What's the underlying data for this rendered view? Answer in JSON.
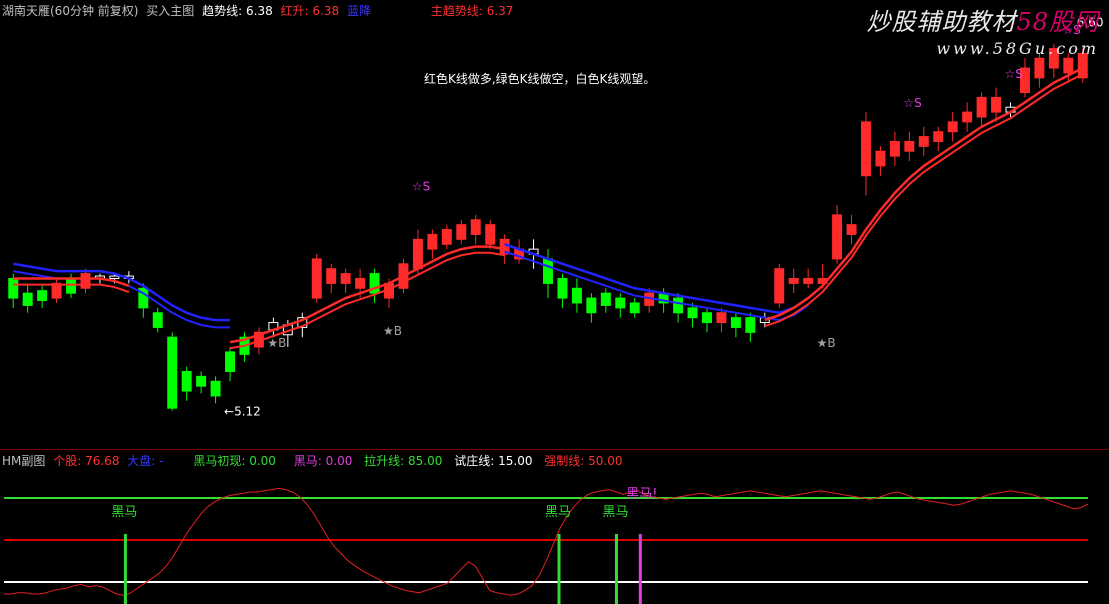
{
  "header": {
    "stock": "湖南天雁(60分钟 前复权)",
    "mode": "买入主图",
    "trend_label": "趋势线:",
    "trend_value": "6.38",
    "red_label": "红升:",
    "red_value": "6.38",
    "blue_label": "蓝降",
    "main_label": "主趋势线:",
    "main_value": "6.37"
  },
  "watermark": {
    "title_pre": "炒股辅助教材",
    "title_brand": "58股网",
    "url": "www.58Gu.com"
  },
  "annotation": "红色K线做多,绿色K线做空，白色K线观望。",
  "sub_header": {
    "name": "HM副图",
    "stock_label": "个股:",
    "stock_value": "76.68",
    "market_label": "大盘:",
    "market_value": "-",
    "hm_first_label": "黑马初现:",
    "hm_first_value": "0.00",
    "hm_label": "黑马:",
    "hm_value": "0.00",
    "rise_label": "拉升线:",
    "rise_value": "85.00",
    "test_label": "试庄线:",
    "test_value": "15.00",
    "crash_label": "强制线:",
    "crash_value": "50.00"
  },
  "colors": {
    "up": "#ff2a2a",
    "down": "#00ff00",
    "neutral": "#ffffff",
    "blue": "#2222ff",
    "magenta": "#e040e0",
    "gray": "#a0a0a0",
    "green_line": "#33dd33",
    "red_line": "#dd0000"
  },
  "chart_data": {
    "type": "candlestick",
    "ylim": [
      5.0,
      6.7
    ],
    "candles": [
      [
        "g",
        5.58,
        5.66,
        5.54,
        5.68
      ],
      [
        "g",
        5.55,
        5.6,
        5.52,
        5.64
      ],
      [
        "g",
        5.57,
        5.61,
        5.54,
        5.63
      ],
      [
        "r",
        5.58,
        5.64,
        5.56,
        5.66
      ],
      [
        "g",
        5.6,
        5.66,
        5.58,
        5.68
      ],
      [
        "r",
        5.62,
        5.68,
        5.6,
        5.7
      ],
      [
        "w",
        5.66,
        5.67,
        5.64,
        5.68
      ],
      [
        "w",
        5.66,
        5.67,
        5.64,
        5.68
      ],
      [
        "w",
        5.66,
        5.67,
        5.64,
        5.69
      ],
      [
        "g",
        5.54,
        5.62,
        5.5,
        5.64
      ],
      [
        "g",
        5.46,
        5.52,
        5.44,
        5.54
      ],
      [
        "g",
        5.13,
        5.42,
        5.12,
        5.44
      ],
      [
        "g",
        5.2,
        5.28,
        5.16,
        5.3
      ],
      [
        "g",
        5.22,
        5.26,
        5.19,
        5.28
      ],
      [
        "g",
        5.18,
        5.24,
        5.15,
        5.26
      ],
      [
        "g",
        5.28,
        5.36,
        5.24,
        5.38
      ],
      [
        "g",
        5.35,
        5.42,
        5.32,
        5.44
      ],
      [
        "r",
        5.38,
        5.44,
        5.35,
        5.46
      ],
      [
        "w",
        5.45,
        5.48,
        5.42,
        5.5
      ],
      [
        "w",
        5.43,
        5.47,
        5.38,
        5.49
      ],
      [
        "w",
        5.46,
        5.5,
        5.42,
        5.52
      ],
      [
        "r",
        5.58,
        5.74,
        5.56,
        5.76
      ],
      [
        "r",
        5.64,
        5.7,
        5.6,
        5.72
      ],
      [
        "r",
        5.64,
        5.68,
        5.6,
        5.7
      ],
      [
        "r",
        5.62,
        5.66,
        5.58,
        5.7
      ],
      [
        "g",
        5.6,
        5.68,
        5.56,
        5.7
      ],
      [
        "r",
        5.58,
        5.64,
        5.54,
        5.66
      ],
      [
        "r",
        5.62,
        5.72,
        5.6,
        5.74
      ],
      [
        "r",
        5.7,
        5.82,
        5.68,
        5.86
      ],
      [
        "r",
        5.78,
        5.84,
        5.74,
        5.86
      ],
      [
        "r",
        5.8,
        5.86,
        5.78,
        5.88
      ],
      [
        "r",
        5.82,
        5.88,
        5.8,
        5.9
      ],
      [
        "r",
        5.84,
        5.9,
        5.8,
        5.92
      ],
      [
        "r",
        5.8,
        5.88,
        5.78,
        5.9
      ],
      [
        "r",
        5.76,
        5.82,
        5.72,
        5.84
      ],
      [
        "r",
        5.74,
        5.78,
        5.72,
        5.82
      ],
      [
        "w",
        5.76,
        5.78,
        5.7,
        5.82
      ],
      [
        "g",
        5.64,
        5.74,
        5.58,
        5.78
      ],
      [
        "g",
        5.58,
        5.66,
        5.54,
        5.68
      ],
      [
        "g",
        5.56,
        5.62,
        5.52,
        5.66
      ],
      [
        "g",
        5.52,
        5.58,
        5.48,
        5.6
      ],
      [
        "g",
        5.55,
        5.6,
        5.52,
        5.62
      ],
      [
        "g",
        5.54,
        5.58,
        5.5,
        5.6
      ],
      [
        "g",
        5.52,
        5.56,
        5.5,
        5.58
      ],
      [
        "r",
        5.55,
        5.6,
        5.52,
        5.62
      ],
      [
        "g",
        5.56,
        5.6,
        5.52,
        5.62
      ],
      [
        "g",
        5.52,
        5.58,
        5.48,
        5.6
      ],
      [
        "g",
        5.5,
        5.54,
        5.46,
        5.56
      ],
      [
        "g",
        5.48,
        5.52,
        5.44,
        5.54
      ],
      [
        "r",
        5.48,
        5.52,
        5.44,
        5.54
      ],
      [
        "g",
        5.46,
        5.5,
        5.42,
        5.52
      ],
      [
        "g",
        5.44,
        5.5,
        5.4,
        5.52
      ],
      [
        "w",
        5.48,
        5.5,
        5.46,
        5.52
      ],
      [
        "r",
        5.56,
        5.7,
        5.54,
        5.72
      ],
      [
        "r",
        5.64,
        5.66,
        5.6,
        5.7
      ],
      [
        "r",
        5.64,
        5.66,
        5.62,
        5.7
      ],
      [
        "r",
        5.64,
        5.66,
        5.62,
        5.72
      ],
      [
        "r",
        5.74,
        5.92,
        5.72,
        5.96
      ],
      [
        "r",
        5.84,
        5.88,
        5.8,
        5.92
      ],
      [
        "r",
        6.08,
        6.3,
        6.0,
        6.34
      ],
      [
        "r",
        6.12,
        6.18,
        6.08,
        6.2
      ],
      [
        "r",
        6.16,
        6.22,
        6.12,
        6.26
      ],
      [
        "r",
        6.18,
        6.22,
        6.14,
        6.26
      ],
      [
        "r",
        6.2,
        6.24,
        6.16,
        6.28
      ],
      [
        "r",
        6.22,
        6.26,
        6.18,
        6.28
      ],
      [
        "r",
        6.26,
        6.3,
        6.22,
        6.34
      ],
      [
        "r",
        6.3,
        6.34,
        6.26,
        6.38
      ],
      [
        "r",
        6.32,
        6.4,
        6.28,
        6.42
      ],
      [
        "r",
        6.34,
        6.4,
        6.3,
        6.44
      ],
      [
        "w",
        6.34,
        6.36,
        6.32,
        6.38
      ],
      [
        "r",
        6.42,
        6.52,
        6.4,
        6.56
      ],
      [
        "r",
        6.48,
        6.56,
        6.44,
        6.58
      ],
      [
        "r",
        6.52,
        6.6,
        6.48,
        6.62
      ],
      [
        "r",
        6.5,
        6.56,
        6.46,
        6.58
      ],
      [
        "r",
        6.48,
        6.58,
        6.46,
        6.6
      ]
    ],
    "trend_ma": [
      5.66,
      5.66,
      5.66,
      5.66,
      5.66,
      5.66,
      5.66,
      5.65,
      5.63,
      5.59,
      5.54,
      5.48,
      5.44,
      5.41,
      5.4,
      5.4,
      5.41,
      5.43,
      5.45,
      5.47,
      5.49,
      5.52,
      5.55,
      5.58,
      5.6,
      5.62,
      5.64,
      5.67,
      5.7,
      5.73,
      5.76,
      5.78,
      5.79,
      5.79,
      5.78,
      5.76,
      5.74,
      5.71,
      5.68,
      5.65,
      5.62,
      5.6,
      5.58,
      5.56,
      5.55,
      5.54,
      5.53,
      5.52,
      5.51,
      5.5,
      5.49,
      5.49,
      5.49,
      5.51,
      5.54,
      5.58,
      5.63,
      5.7,
      5.77,
      5.86,
      5.94,
      6.01,
      6.07,
      6.12,
      6.16,
      6.2,
      6.24,
      6.28,
      6.31,
      6.34,
      6.38,
      6.42,
      6.46,
      6.49,
      6.52
    ],
    "blue_ma": [
      5.72,
      5.71,
      5.7,
      5.69,
      5.69,
      5.69,
      5.69,
      5.68,
      5.66,
      5.63,
      5.59,
      5.55,
      5.52,
      5.5,
      5.49,
      5.49,
      5.5,
      5.52,
      5.54,
      5.56,
      5.58,
      5.6,
      5.62,
      5.64,
      5.66,
      5.68,
      5.7,
      5.72,
      5.74,
      5.76,
      5.78,
      5.8,
      5.81,
      5.81,
      5.8,
      5.78,
      5.76,
      5.74,
      5.72,
      5.7,
      5.68,
      5.66,
      5.64,
      5.62,
      5.61,
      5.6,
      5.59,
      5.58,
      5.57,
      5.56,
      5.55,
      5.54,
      5.53,
      5.52,
      5.54,
      5.58,
      5.63,
      5.7,
      5.77,
      5.86,
      5.94,
      6.01,
      6.07,
      6.12,
      6.16,
      6.2,
      6.24,
      6.28,
      6.31,
      6.34,
      6.38,
      6.42,
      6.46,
      6.49,
      6.52
    ],
    "markers": [
      {
        "i": 15,
        "text": "←5.12",
        "price": 5.1,
        "color": "#ffffff"
      },
      {
        "i": 18,
        "text": "★B",
        "price": 5.38,
        "color": "#a0a0a0"
      },
      {
        "i": 26,
        "text": "★B",
        "price": 5.43,
        "color": "#a0a0a0"
      },
      {
        "i": 28,
        "text": "☆S",
        "price": 6.02,
        "color": "#e040e0"
      },
      {
        "i": 56,
        "text": "★B",
        "price": 5.38,
        "color": "#a0a0a0"
      },
      {
        "i": 62,
        "text": "☆S",
        "price": 6.36,
        "color": "#e040e0"
      },
      {
        "i": 69,
        "text": "☆S",
        "price": 6.48,
        "color": "#e040e0"
      },
      {
        "i": 73,
        "text": "☆S",
        "price": 6.66,
        "color": "#e040e0"
      },
      {
        "i": 74,
        "text": "6.60",
        "price": 6.69,
        "color": "#ffffff"
      }
    ],
    "sub": {
      "ylim": [
        0,
        100
      ],
      "levels": {
        "rise": 85,
        "crash": 50,
        "test": 15
      },
      "line": [
        5,
        5,
        6,
        6,
        5,
        5,
        6,
        8,
        9,
        10,
        12,
        13,
        11,
        12,
        11,
        8,
        5,
        4,
        6,
        10,
        14,
        18,
        22,
        28,
        36,
        46,
        56,
        64,
        72,
        78,
        82,
        85,
        87,
        88,
        89,
        90,
        90,
        91,
        92,
        93,
        92,
        90,
        86,
        80,
        72,
        62,
        52,
        44,
        38,
        32,
        28,
        24,
        21,
        18,
        15,
        12,
        10,
        8,
        7,
        6,
        8,
        10,
        12,
        14,
        20,
        26,
        32,
        28,
        18,
        8,
        6,
        5,
        4,
        5,
        8,
        12,
        20,
        32,
        46,
        60,
        70,
        78,
        84,
        88,
        90,
        91,
        92,
        90,
        88,
        90,
        91,
        88,
        86,
        85,
        84,
        85,
        86,
        87,
        88,
        89,
        88,
        86,
        87,
        88,
        89,
        90,
        91,
        90,
        89,
        88,
        87,
        86,
        87,
        88,
        89,
        90,
        91,
        90,
        89,
        88,
        87,
        86,
        85,
        84,
        85,
        87,
        89,
        90,
        88,
        86,
        84,
        83,
        82,
        81,
        80,
        79,
        80,
        82,
        84,
        86,
        88,
        89,
        90,
        91,
        90,
        89,
        88,
        86,
        84,
        82,
        80,
        78,
        76,
        77,
        80
      ],
      "signals": [
        {
          "label": "黑马",
          "t": 0.112,
          "color": "#33dd33"
        },
        {
          "label": "黑马",
          "t": 0.512,
          "color": "#33dd33"
        },
        {
          "label": "黑马",
          "t": 0.565,
          "color": "#33dd33"
        },
        {
          "label": "黑马!",
          "t": 0.587,
          "color": "#e040e0"
        }
      ]
    }
  }
}
